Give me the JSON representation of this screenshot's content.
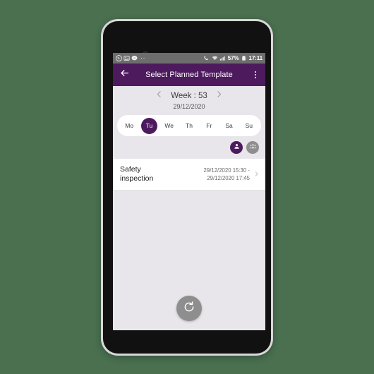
{
  "theme": {
    "page_background": "#4a7050",
    "accent_purple": "#4d1a5e",
    "screen_background": "#e8e6eb",
    "card_white": "#ffffff",
    "muted_gray": "#8e8e8e",
    "status_bar_gray": "#6d6d6d"
  },
  "status_bar": {
    "icons_left": [
      "whatsapp-icon",
      "image-icon",
      "message-icon"
    ],
    "overflow_dots": "··",
    "icons_right": [
      "phone-icon",
      "wifi-icon",
      "signal-icon"
    ],
    "battery_percent": "57%",
    "battery_icon": "battery-icon",
    "time": "17:11"
  },
  "app_bar": {
    "back_icon": "back-arrow-icon",
    "title": "Select Planned Template",
    "overflow_icon": "overflow-menu-icon"
  },
  "week_nav": {
    "prev_icon": "chevron-left-icon",
    "label": "Week : 53",
    "next_icon": "chevron-right-icon",
    "date": "29/12/2020"
  },
  "day_selector": {
    "days": [
      {
        "label": "Mo",
        "selected": false
      },
      {
        "label": "Tu",
        "selected": true
      },
      {
        "label": "We",
        "selected": false
      },
      {
        "label": "Th",
        "selected": false
      },
      {
        "label": "Fr",
        "selected": false
      },
      {
        "label": "Sa",
        "selected": false
      },
      {
        "label": "Su",
        "selected": false
      }
    ]
  },
  "filters": [
    {
      "icon": "person-icon",
      "active": true
    },
    {
      "icon": "group-icon",
      "active": false
    }
  ],
  "template_list": {
    "items": [
      {
        "title": "Safety inspection",
        "start": "29/12/2020 15:30 -",
        "end": "29/12/2020 17:45",
        "chevron_icon": "chevron-right-icon"
      }
    ]
  },
  "fab": {
    "icon": "refresh-icon",
    "color": "#8e8e8e"
  }
}
